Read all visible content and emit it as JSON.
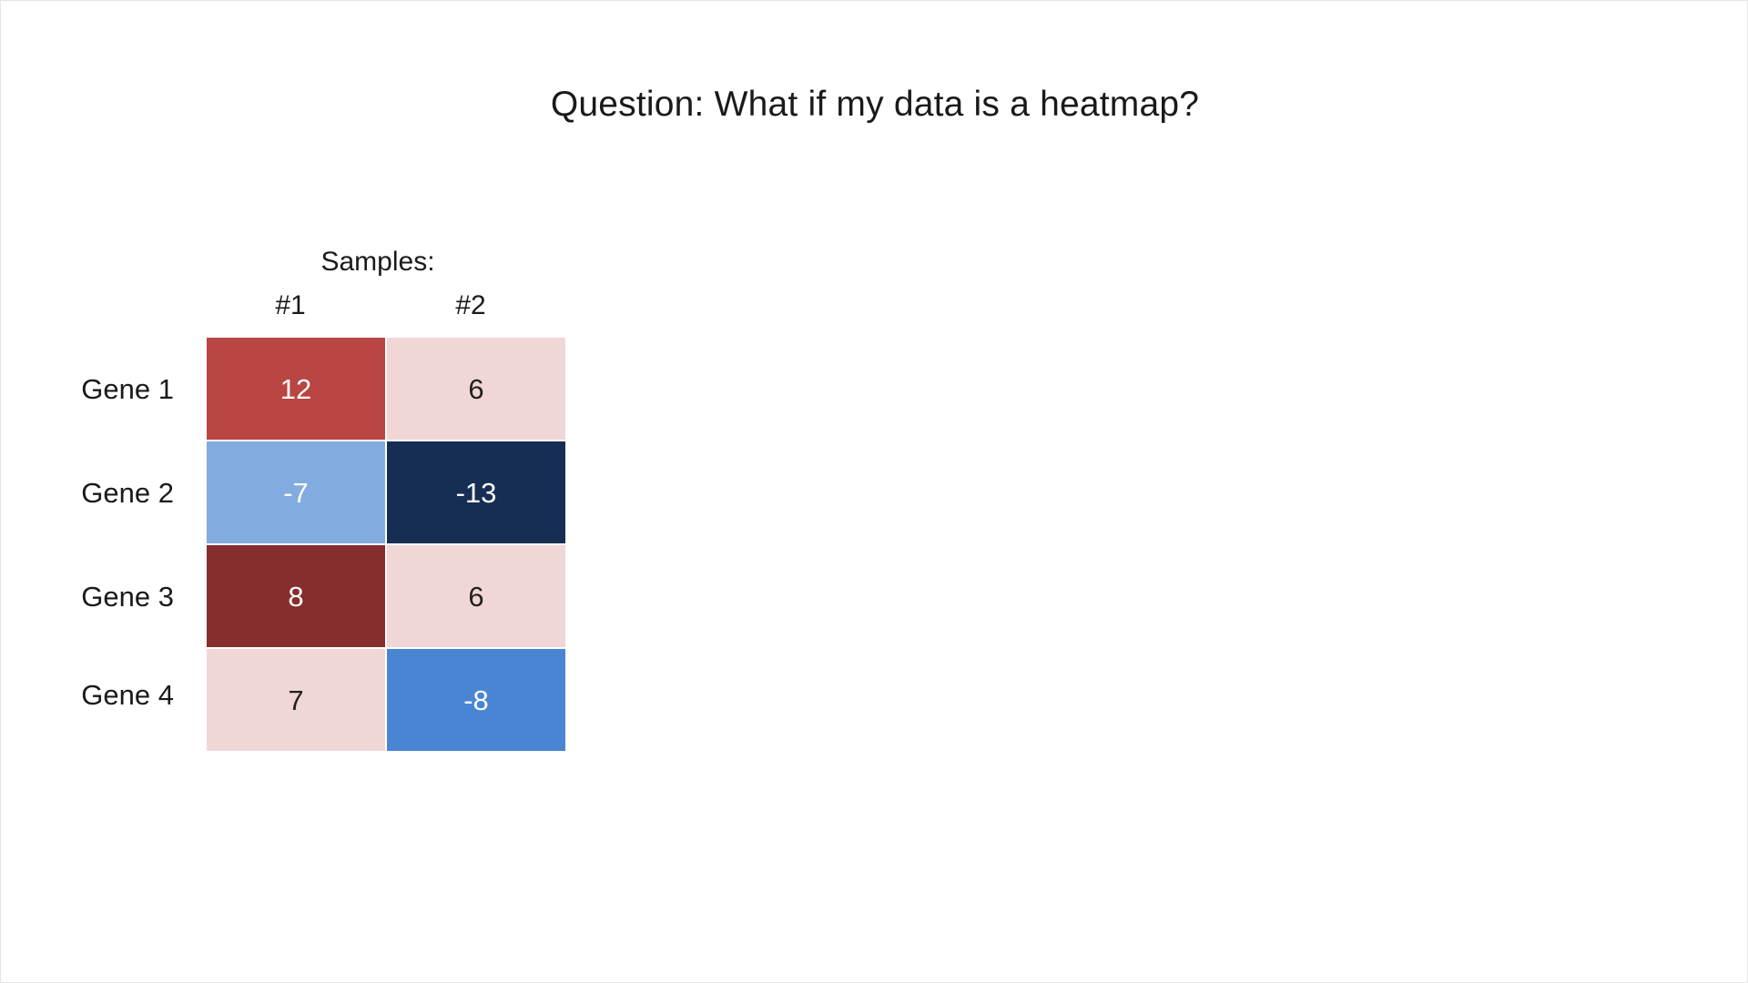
{
  "title": "Question: What if my data is a heatmap?",
  "chart_data": {
    "type": "heatmap",
    "column_header": "Samples:",
    "columns": [
      "#1",
      "#2"
    ],
    "rows": [
      "Gene 1",
      "Gene 2",
      "Gene 3",
      "Gene 4"
    ],
    "values": [
      [
        12,
        6
      ],
      [
        -7,
        -13
      ],
      [
        8,
        6
      ],
      [
        7,
        -8
      ]
    ],
    "cell_colors": [
      [
        "#b94643",
        "#f0d7d6"
      ],
      [
        "#82abe0",
        "#172e54"
      ],
      [
        "#862d2d",
        "#f0d7d6"
      ],
      [
        "#f0d7d6",
        "#4a85d4"
      ]
    ],
    "text_colors": [
      [
        "#ffffff",
        "#222222"
      ],
      [
        "#ffffff",
        "#ffffff"
      ],
      [
        "#ffffff",
        "#222222"
      ],
      [
        "#222222",
        "#ffffff"
      ]
    ]
  }
}
